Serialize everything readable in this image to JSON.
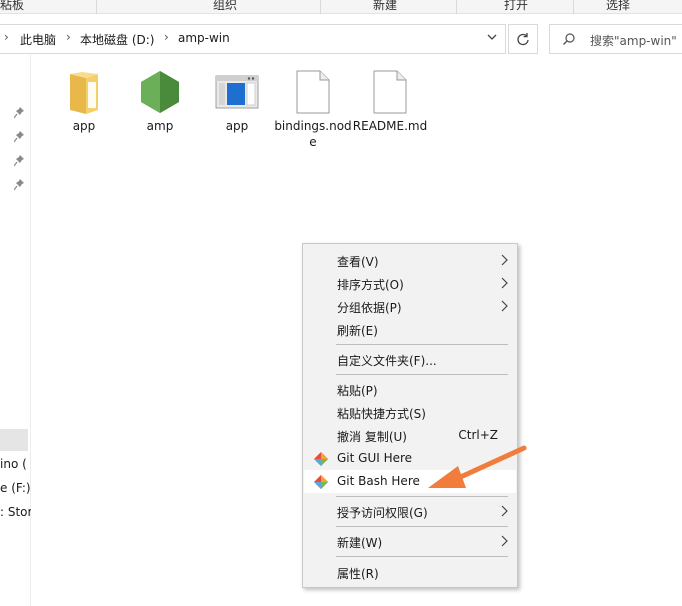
{
  "ribbon": {
    "groups": [
      "粘板",
      "组织",
      "新建",
      "打开",
      "选择"
    ]
  },
  "address": {
    "crumbs": [
      "此电脑",
      "本地磁盘 (D:)",
      "amp-win"
    ]
  },
  "search": {
    "placeholder": "搜索\"amp-win\""
  },
  "nav": {
    "items": [
      "ino (",
      "e (F:)",
      ": Stor"
    ]
  },
  "files": [
    {
      "label": "app",
      "icon": "folder-icon"
    },
    {
      "label": "amp",
      "icon": "node-hexagon-icon"
    },
    {
      "label": "app",
      "icon": "application-window-icon"
    },
    {
      "label": "bindings.node",
      "icon": "file-icon"
    },
    {
      "label": "README.md",
      "icon": "file-icon"
    }
  ],
  "menu": {
    "items": [
      {
        "label": "查看(V)",
        "submenu": true
      },
      {
        "label": "排序方式(O)",
        "submenu": true
      },
      {
        "label": "分组依据(P)",
        "submenu": true
      },
      {
        "label": "刷新(E)"
      },
      {
        "label": "自定义文件夹(F)..."
      },
      {
        "label": "粘贴(P)"
      },
      {
        "label": "粘贴快捷方式(S)"
      },
      {
        "label": "撤消 复制(U)",
        "shortcut": "Ctrl+Z"
      },
      {
        "label": "Git GUI Here",
        "icon": "git-icon"
      },
      {
        "label": "Git Bash Here",
        "icon": "git-icon",
        "highlighted": true
      },
      {
        "label": "授予访问权限(G)",
        "submenu": true
      },
      {
        "label": "新建(W)",
        "submenu": true
      },
      {
        "label": "属性(R)"
      }
    ]
  },
  "colors": {
    "annotation_arrow": "#f07d3c",
    "menu_bg": "#f2f2f2",
    "folder": "#f5cf69",
    "node_green": "#5fa04e"
  }
}
